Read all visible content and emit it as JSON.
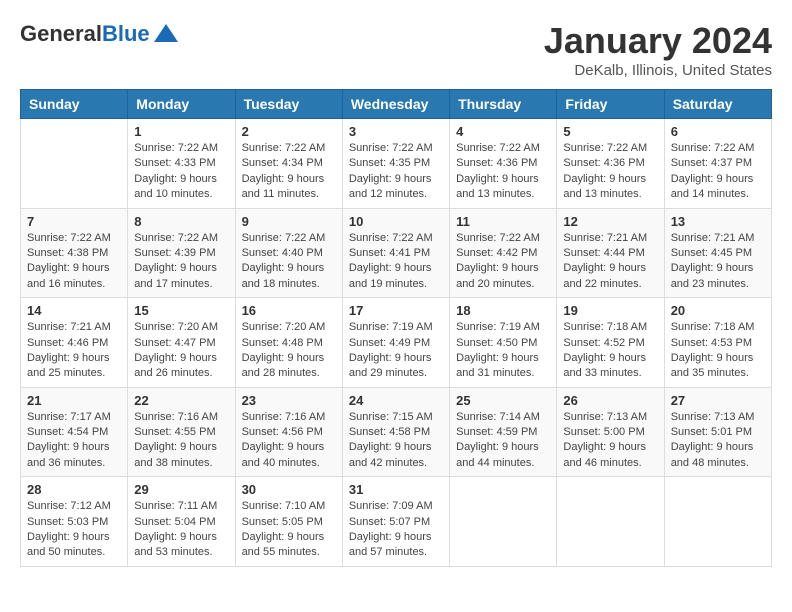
{
  "logo": {
    "general": "General",
    "blue": "Blue"
  },
  "title": "January 2024",
  "subtitle": "DeKalb, Illinois, United States",
  "days_header": [
    "Sunday",
    "Monday",
    "Tuesday",
    "Wednesday",
    "Thursday",
    "Friday",
    "Saturday"
  ],
  "weeks": [
    [
      {
        "day": "",
        "info": ""
      },
      {
        "day": "1",
        "info": "Sunrise: 7:22 AM\nSunset: 4:33 PM\nDaylight: 9 hours\nand 10 minutes."
      },
      {
        "day": "2",
        "info": "Sunrise: 7:22 AM\nSunset: 4:34 PM\nDaylight: 9 hours\nand 11 minutes."
      },
      {
        "day": "3",
        "info": "Sunrise: 7:22 AM\nSunset: 4:35 PM\nDaylight: 9 hours\nand 12 minutes."
      },
      {
        "day": "4",
        "info": "Sunrise: 7:22 AM\nSunset: 4:36 PM\nDaylight: 9 hours\nand 13 minutes."
      },
      {
        "day": "5",
        "info": "Sunrise: 7:22 AM\nSunset: 4:36 PM\nDaylight: 9 hours\nand 13 minutes."
      },
      {
        "day": "6",
        "info": "Sunrise: 7:22 AM\nSunset: 4:37 PM\nDaylight: 9 hours\nand 14 minutes."
      }
    ],
    [
      {
        "day": "7",
        "info": "Sunrise: 7:22 AM\nSunset: 4:38 PM\nDaylight: 9 hours\nand 16 minutes."
      },
      {
        "day": "8",
        "info": "Sunrise: 7:22 AM\nSunset: 4:39 PM\nDaylight: 9 hours\nand 17 minutes."
      },
      {
        "day": "9",
        "info": "Sunrise: 7:22 AM\nSunset: 4:40 PM\nDaylight: 9 hours\nand 18 minutes."
      },
      {
        "day": "10",
        "info": "Sunrise: 7:22 AM\nSunset: 4:41 PM\nDaylight: 9 hours\nand 19 minutes."
      },
      {
        "day": "11",
        "info": "Sunrise: 7:22 AM\nSunset: 4:42 PM\nDaylight: 9 hours\nand 20 minutes."
      },
      {
        "day": "12",
        "info": "Sunrise: 7:21 AM\nSunset: 4:44 PM\nDaylight: 9 hours\nand 22 minutes."
      },
      {
        "day": "13",
        "info": "Sunrise: 7:21 AM\nSunset: 4:45 PM\nDaylight: 9 hours\nand 23 minutes."
      }
    ],
    [
      {
        "day": "14",
        "info": "Sunrise: 7:21 AM\nSunset: 4:46 PM\nDaylight: 9 hours\nand 25 minutes."
      },
      {
        "day": "15",
        "info": "Sunrise: 7:20 AM\nSunset: 4:47 PM\nDaylight: 9 hours\nand 26 minutes."
      },
      {
        "day": "16",
        "info": "Sunrise: 7:20 AM\nSunset: 4:48 PM\nDaylight: 9 hours\nand 28 minutes."
      },
      {
        "day": "17",
        "info": "Sunrise: 7:19 AM\nSunset: 4:49 PM\nDaylight: 9 hours\nand 29 minutes."
      },
      {
        "day": "18",
        "info": "Sunrise: 7:19 AM\nSunset: 4:50 PM\nDaylight: 9 hours\nand 31 minutes."
      },
      {
        "day": "19",
        "info": "Sunrise: 7:18 AM\nSunset: 4:52 PM\nDaylight: 9 hours\nand 33 minutes."
      },
      {
        "day": "20",
        "info": "Sunrise: 7:18 AM\nSunset: 4:53 PM\nDaylight: 9 hours\nand 35 minutes."
      }
    ],
    [
      {
        "day": "21",
        "info": "Sunrise: 7:17 AM\nSunset: 4:54 PM\nDaylight: 9 hours\nand 36 minutes."
      },
      {
        "day": "22",
        "info": "Sunrise: 7:16 AM\nSunset: 4:55 PM\nDaylight: 9 hours\nand 38 minutes."
      },
      {
        "day": "23",
        "info": "Sunrise: 7:16 AM\nSunset: 4:56 PM\nDaylight: 9 hours\nand 40 minutes."
      },
      {
        "day": "24",
        "info": "Sunrise: 7:15 AM\nSunset: 4:58 PM\nDaylight: 9 hours\nand 42 minutes."
      },
      {
        "day": "25",
        "info": "Sunrise: 7:14 AM\nSunset: 4:59 PM\nDaylight: 9 hours\nand 44 minutes."
      },
      {
        "day": "26",
        "info": "Sunrise: 7:13 AM\nSunset: 5:00 PM\nDaylight: 9 hours\nand 46 minutes."
      },
      {
        "day": "27",
        "info": "Sunrise: 7:13 AM\nSunset: 5:01 PM\nDaylight: 9 hours\nand 48 minutes."
      }
    ],
    [
      {
        "day": "28",
        "info": "Sunrise: 7:12 AM\nSunset: 5:03 PM\nDaylight: 9 hours\nand 50 minutes."
      },
      {
        "day": "29",
        "info": "Sunrise: 7:11 AM\nSunset: 5:04 PM\nDaylight: 9 hours\nand 53 minutes."
      },
      {
        "day": "30",
        "info": "Sunrise: 7:10 AM\nSunset: 5:05 PM\nDaylight: 9 hours\nand 55 minutes."
      },
      {
        "day": "31",
        "info": "Sunrise: 7:09 AM\nSunset: 5:07 PM\nDaylight: 9 hours\nand 57 minutes."
      },
      {
        "day": "",
        "info": ""
      },
      {
        "day": "",
        "info": ""
      },
      {
        "day": "",
        "info": ""
      }
    ]
  ]
}
